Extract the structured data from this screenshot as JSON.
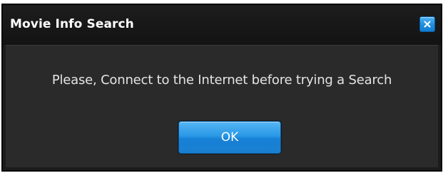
{
  "dialog": {
    "title": "Movie Info Search",
    "message": "Please, Connect to the Internet before trying a Search",
    "ok_label": "OK",
    "close_icon": "close-icon",
    "accent_color": "#1f8ee0"
  }
}
